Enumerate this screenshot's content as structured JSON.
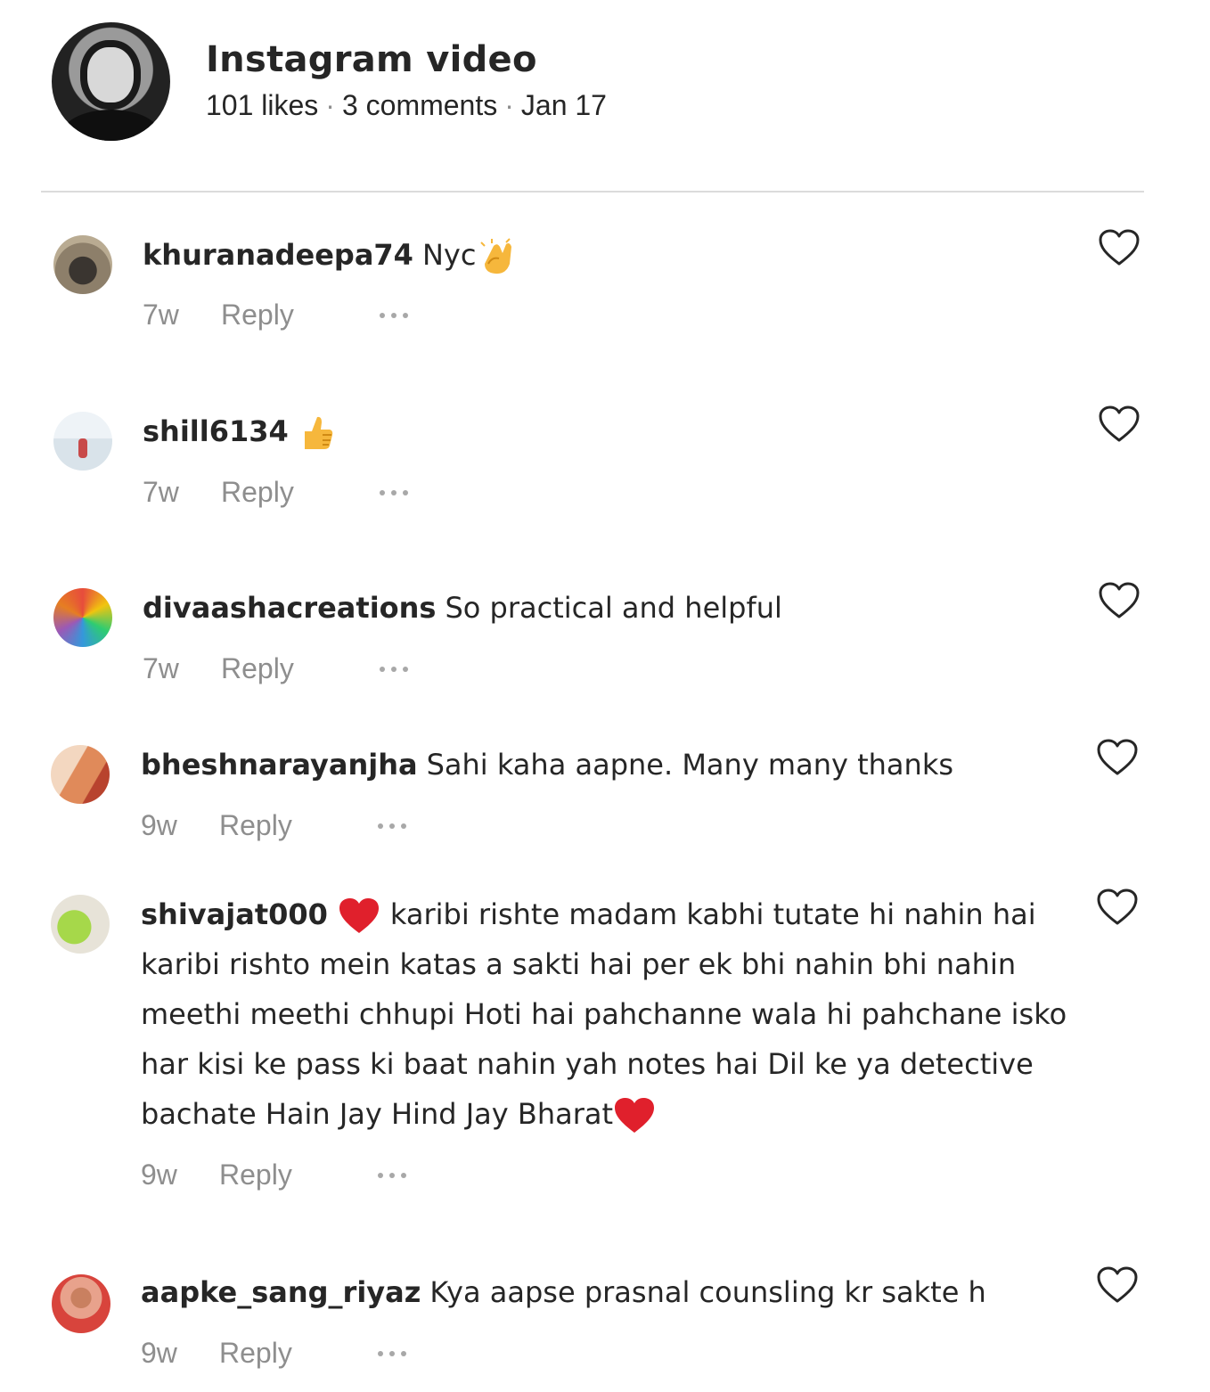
{
  "post": {
    "title": "Instagram video",
    "likes": "101 likes",
    "comments": "3 comments",
    "date": "Jan 17"
  },
  "comments": [
    {
      "user": "khuranadeepa74",
      "text": "Nyc",
      "emoji": "clapping-hands",
      "time": "7w",
      "reply": "Reply"
    },
    {
      "user": "shill6134",
      "text": "",
      "emoji": "thumbs-up",
      "time": "7w",
      "reply": "Reply"
    },
    {
      "user": "divaashacreations",
      "text": "So practical and helpful",
      "time": "7w",
      "reply": "Reply"
    },
    {
      "user": "bheshnarayanjha",
      "text": "Sahi kaha aapne. Many many thanks",
      "time": "9w",
      "reply": "Reply"
    },
    {
      "user": "shivajat000",
      "text_before": "karibi rishte madam kabhi tutate hi nahin hai karibi rishto mein katas a sakti hai per ek bhi nahin bhi nahin meethi meethi chhupi Hoti hai pahchanne wala hi pahchane isko har kisi ke pass ki baat nahin yah notes hai Dil ke ya detective bachate Hain Jay Hind Jay Bharat",
      "emoji": "red-heart",
      "time": "9w",
      "reply": "Reply"
    },
    {
      "user": "aapke_sang_riyaz",
      "text": "Kya aapse prasnal counsling kr sakte h",
      "time": "9w",
      "reply": "Reply"
    }
  ],
  "colors": {
    "text": "#262626",
    "secondary": "#8e8e8e",
    "divider": "#dbdbdb",
    "heart_emoji": "#e0202c",
    "clap_emoji": "#f6b73c"
  },
  "icons": {
    "like": "heart-outline-icon",
    "more": "more-horizontal-icon"
  }
}
